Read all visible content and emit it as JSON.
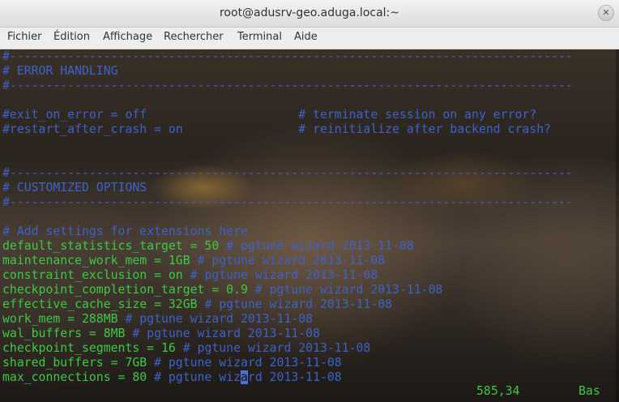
{
  "window": {
    "title": "root@adusrv-geo.aduga.local:~",
    "close_glyph": "✕"
  },
  "menu": [
    "Fichier",
    "Édition",
    "Affichage",
    "Rechercher",
    "Terminal",
    "Aide"
  ],
  "lines": [
    {
      "type": "comment",
      "text": "#------------------------------------------------------------------------------"
    },
    {
      "type": "comment",
      "text": "# ERROR HANDLING"
    },
    {
      "type": "comment",
      "text": "#------------------------------------------------------------------------------"
    },
    {
      "type": "blank",
      "text": ""
    },
    {
      "type": "comment",
      "text": "#exit_on_error = off                     # terminate session on any error?"
    },
    {
      "type": "comment",
      "text": "#restart_after_crash = on                # reinitialize after backend crash?"
    },
    {
      "type": "blank",
      "text": ""
    },
    {
      "type": "blank",
      "text": ""
    },
    {
      "type": "comment",
      "text": "#------------------------------------------------------------------------------"
    },
    {
      "type": "comment",
      "text": "# CUSTOMIZED OPTIONS"
    },
    {
      "type": "comment",
      "text": "#------------------------------------------------------------------------------"
    },
    {
      "type": "blank",
      "text": ""
    },
    {
      "type": "comment",
      "text": "# Add settings for extensions here"
    },
    {
      "type": "setting",
      "code": "default_statistics_target = 50",
      "comment": " # pgtune wizard 2013-11-08"
    },
    {
      "type": "setting",
      "code": "maintenance_work_mem = 1GB",
      "comment": " # pgtune wizard 2013-11-08"
    },
    {
      "type": "setting",
      "code": "constraint_exclusion = on",
      "comment": " # pgtune wizard 2013-11-08"
    },
    {
      "type": "setting",
      "code": "checkpoint_completion_target = 0.9",
      "comment": " # pgtune wizard 2013-11-08"
    },
    {
      "type": "setting",
      "code": "effective_cache_size = 32GB",
      "comment": " # pgtune wizard 2013-11-08"
    },
    {
      "type": "setting",
      "code": "work_mem = 288MB",
      "comment": " # pgtune wizard 2013-11-08"
    },
    {
      "type": "setting",
      "code": "wal_buffers = 8MB",
      "comment": " # pgtune wizard 2013-11-08"
    },
    {
      "type": "setting",
      "code": "checkpoint_segments = 16",
      "comment": " # pgtune wizard 2013-11-08"
    },
    {
      "type": "setting",
      "code": "shared_buffers = 7GB",
      "comment": " # pgtune wizard 2013-11-08"
    },
    {
      "type": "setting",
      "code": "max_connections = 80",
      "comment_before": " # pgtune wiz",
      "cursor_char": "a",
      "comment_after": "rd 2013-11-08"
    }
  ],
  "status": {
    "position": "585,34",
    "scroll": "Bas"
  }
}
